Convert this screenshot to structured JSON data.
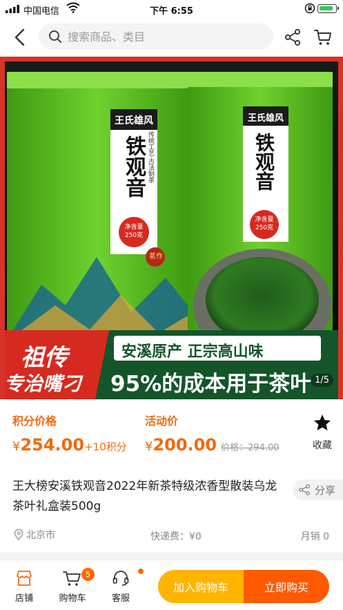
{
  "status_bar": {
    "carrier": "中国电信",
    "time": "下午 6:55"
  },
  "header": {
    "search_placeholder": "搜索商品、类目",
    "icons": [
      "back-icon",
      "search-icon",
      "share-icon",
      "cart-icon"
    ]
  },
  "hero": {
    "brand": "王氏雄风",
    "product_name": "铁观音",
    "side_text": "传统工艺·古法制茶",
    "net_weight": "净含量250克",
    "seal": "茗作",
    "banner_left_line1": "祖传",
    "banner_left_line2": "专治嘴刁",
    "banner_right_top": "安溪原产 正宗高山味",
    "banner_right_bottom": "95%的成本用于茶叶",
    "page_indicator": "1/5",
    "colors": {
      "frame": "#d8332a",
      "tin": "#5bbf1f",
      "banner_green": "#14552a"
    }
  },
  "price": {
    "points_label": "积分价格",
    "points_currency": "¥",
    "points_value": "254.00",
    "points_extra": "+10积分",
    "promo_label": "活动价",
    "promo_currency": "¥",
    "promo_value": "200.00",
    "original_price": "价格：294.00",
    "favorite_label": "收藏",
    "accent_color": "#f26a0d"
  },
  "product": {
    "title": "王大榜安溪铁观音2022年新茶特级浓香型散装乌龙茶叶礼盒装500g",
    "share_label": "分享"
  },
  "meta": {
    "location": "北京市",
    "shipping": "快递费：¥0",
    "monthly_sales": "月销 0"
  },
  "bottom_bar": {
    "store_label": "店铺",
    "cart_label": "购物车",
    "cart_badge": "5",
    "service_label": "客服",
    "add_cart_label": "加入购物车",
    "buy_now_label": "立即购买"
  }
}
